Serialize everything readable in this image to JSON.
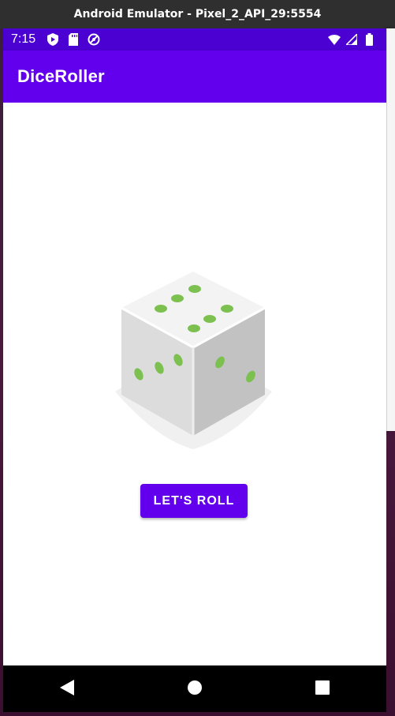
{
  "window": {
    "title": "Android Emulator - Pixel_2_API_29:5554"
  },
  "status_bar": {
    "time": "7:15",
    "left_icons": [
      "shield-icon",
      "sd-card-icon",
      "no-data-icon"
    ],
    "right_icons": [
      "wifi-icon",
      "signal-icon",
      "battery-icon"
    ],
    "background": "#4b01d1"
  },
  "app_bar": {
    "title": "DiceRoller",
    "background": "#6200ee"
  },
  "main": {
    "dice": {
      "icon": "dice-icon",
      "pip_color": "#7cc04f"
    },
    "roll_button": {
      "label": "LET'S ROLL",
      "background": "#6200ee"
    }
  },
  "nav_bar": {
    "buttons": [
      "back-icon",
      "home-icon",
      "recents-icon"
    ]
  }
}
